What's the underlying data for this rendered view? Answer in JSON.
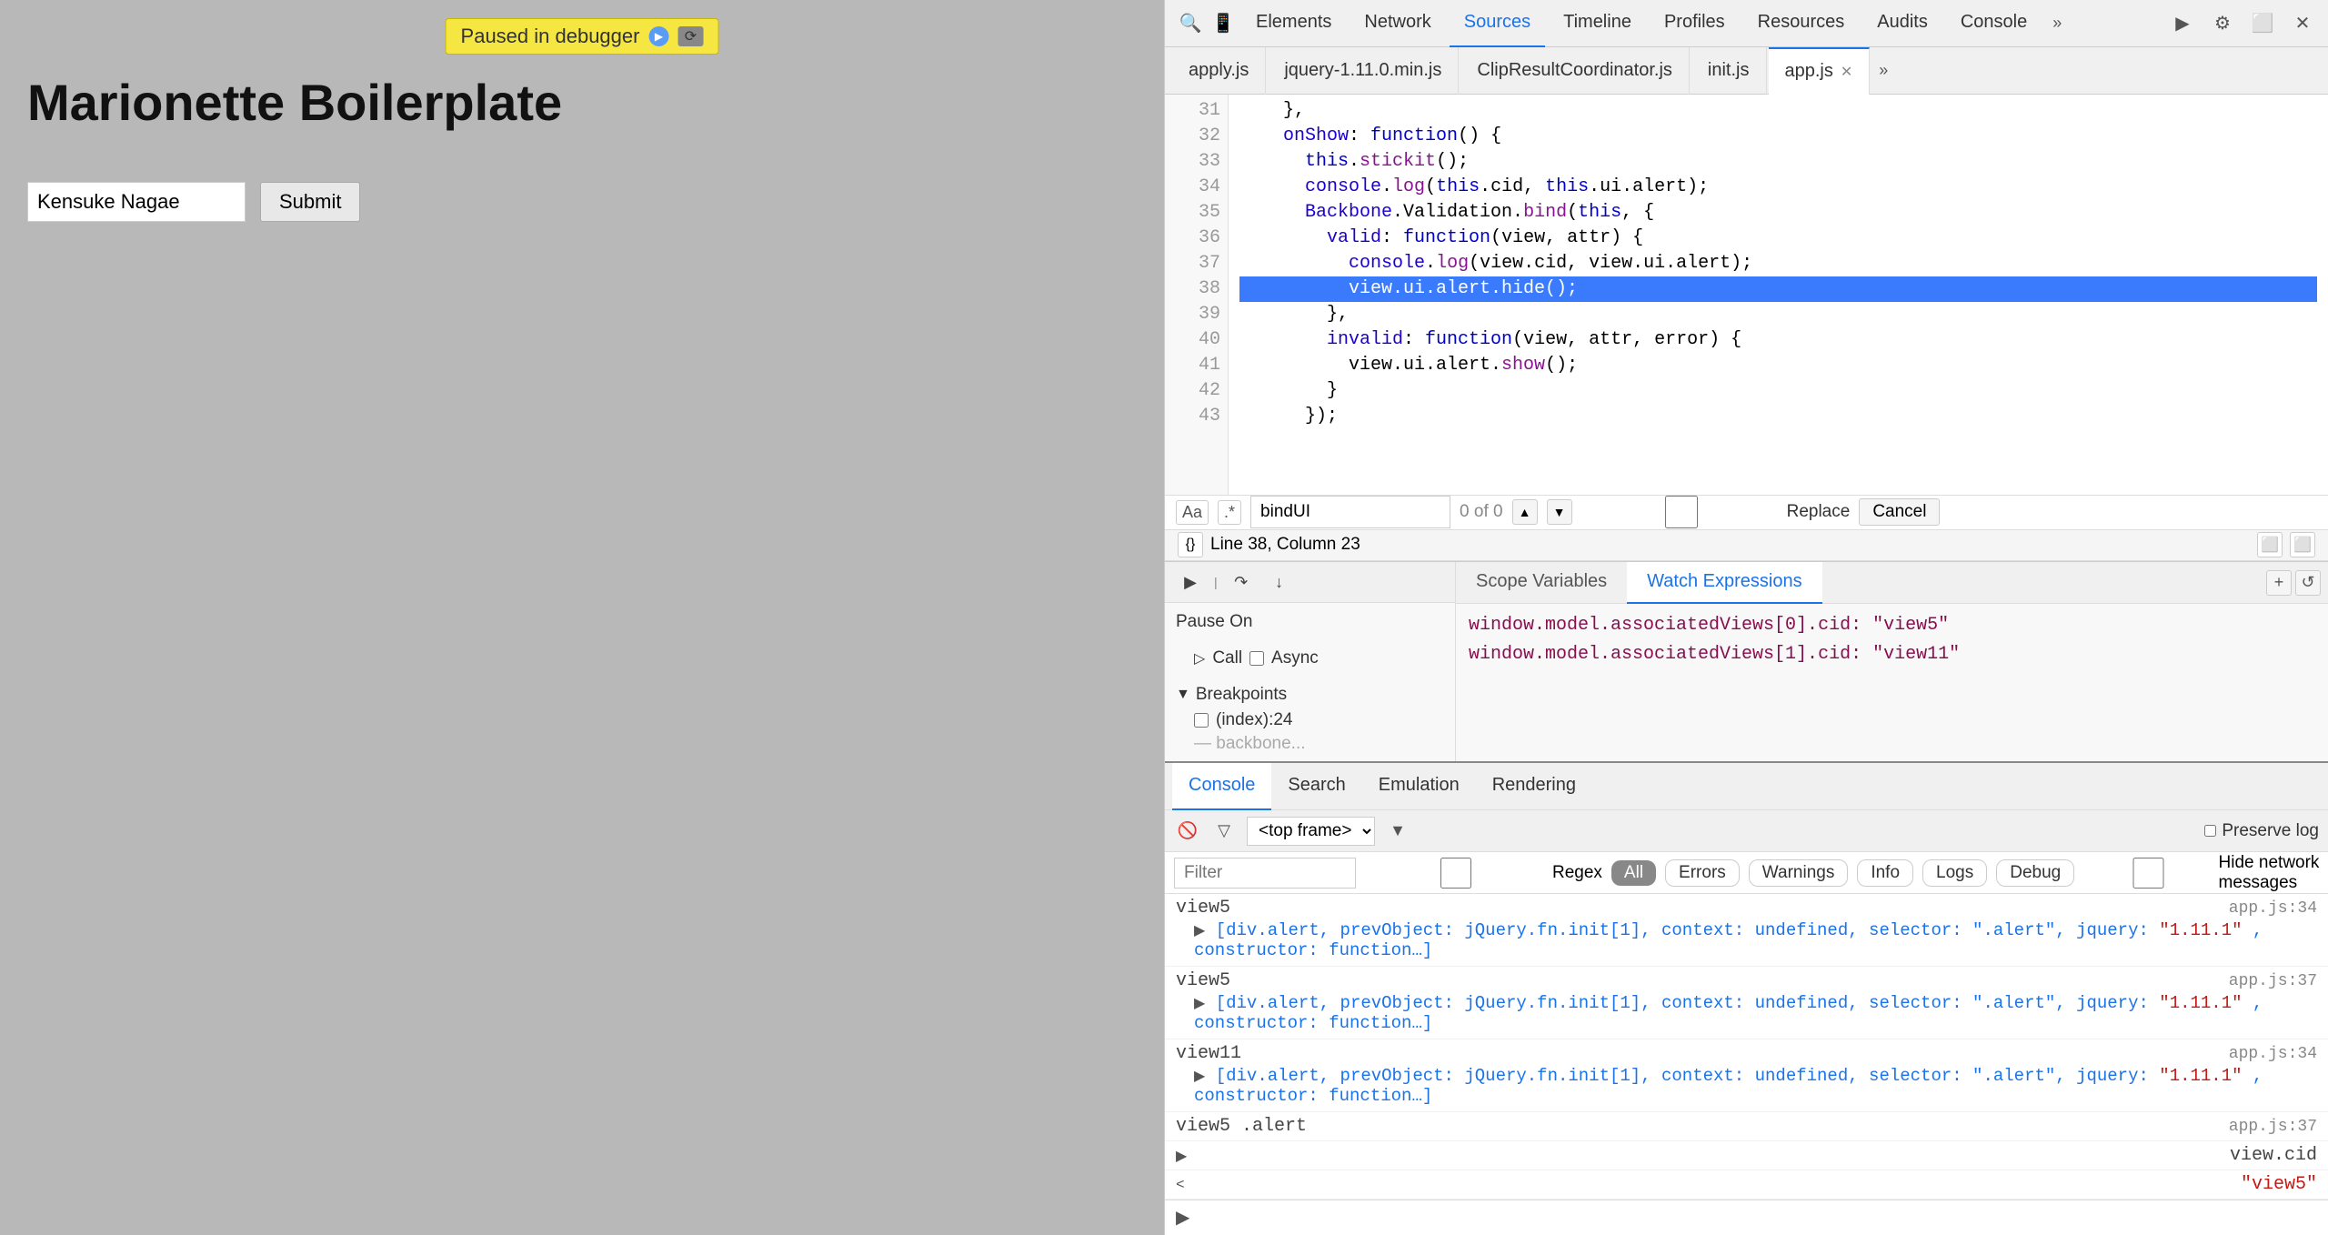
{
  "app": {
    "title": "Marionette Boilerplate",
    "paused_banner": "Paused in debugger",
    "form": {
      "input_value": "Kensuke Nagae",
      "submit_label": "Submit"
    }
  },
  "devtools": {
    "nav_tabs": [
      "Elements",
      "Network",
      "Sources",
      "Timeline",
      "Profiles",
      "Resources",
      "Audits",
      "Console"
    ],
    "active_nav_tab": "Sources",
    "file_tabs": [
      "apply.js",
      "jquery-1.11.0.min.js",
      "ClipResultCoordinator.js",
      "init.js",
      "app.js"
    ],
    "active_file_tab": "app.js",
    "status_bar": {
      "line_col": "Line 38, Column 23"
    },
    "search": {
      "query": "bindUI",
      "count": "0 of 0",
      "replace_label": "Replace",
      "cancel_label": "Cancel"
    },
    "debugger": {
      "pause_on_label": "Pause On",
      "call_async_label": "Call ▷ Async",
      "breakpoints_label": "Breakpoints",
      "breakpoint_item": "(index):24",
      "tabs": [
        "Scope Variables",
        "Watch Expressions"
      ],
      "active_tab": "Watch Expressions",
      "watch_expressions": [
        "window.model.associatedViews[0].cid: \"view5\"",
        "window.model.associatedViews[1].cid: \"view11\""
      ]
    },
    "console": {
      "tabs": [
        "Console",
        "Search",
        "Emulation",
        "Rendering"
      ],
      "active_tab": "Console",
      "frame": "<top frame>",
      "preserve_log_label": "Preserve log",
      "filter_placeholder": "Filter",
      "regex_label": "Regex",
      "filter_btns": [
        "All",
        "Errors",
        "Warnings",
        "Info",
        "Logs",
        "Debug"
      ],
      "hide_network_label": "Hide network messages",
      "entries": [
        {
          "id": 1,
          "text": "view5",
          "location": "app.js:34",
          "expanded": true,
          "content": "[div.alert, prevObject: jQuery.fn.init[1], context: undefined, selector: \".alert\", jquery: \"1.11.1\", constructor: function…]"
        },
        {
          "id": 2,
          "text": "view5",
          "location": "app.js:37",
          "expanded": true,
          "content": "[div.alert, prevObject: jQuery.fn.init[1], context: undefined, selector: \".alert\", jquery: \"1.11.1\", constructor: function…]"
        },
        {
          "id": 3,
          "text": "view11",
          "location": "app.js:34",
          "expanded": true,
          "content": "[div.alert, prevObject: jQuery.fn.init[1], context: undefined, selector: \".alert\", jquery: \"1.11.1\", constructor: function…]"
        },
        {
          "id": 4,
          "text": "view5 .alert",
          "location": "app.js:37",
          "expanded": false,
          "content": ""
        },
        {
          "id": 5,
          "text": "view.cid",
          "location": "",
          "expanded": false,
          "content": ""
        },
        {
          "id": 6,
          "text": "\"view5\"",
          "location": "",
          "expanded": false,
          "is_value": true,
          "content": ""
        }
      ],
      "prompt": "|"
    },
    "code": {
      "lines": [
        {
          "num": 31,
          "text": "    },"
        },
        {
          "num": 32,
          "text": "    onShow: function() {"
        },
        {
          "num": 33,
          "text": "      this.stickit();"
        },
        {
          "num": 34,
          "text": "      console.log(this.cid, this.ui.alert);"
        },
        {
          "num": 35,
          "text": "      Backbone.Validation.bind(this, {"
        },
        {
          "num": 36,
          "text": "        valid: function(view, attr) {"
        },
        {
          "num": 37,
          "text": "          console.log(view.cid, view.ui.alert);"
        },
        {
          "num": 38,
          "text": "          view.ui.alert.hide();",
          "highlighted": true
        },
        {
          "num": 39,
          "text": "        },"
        },
        {
          "num": 40,
          "text": "        invalid: function(view, attr, error) {"
        },
        {
          "num": 41,
          "text": "          view.ui.alert.show();"
        },
        {
          "num": 42,
          "text": "        }"
        },
        {
          "num": 43,
          "text": "      });"
        }
      ]
    }
  }
}
